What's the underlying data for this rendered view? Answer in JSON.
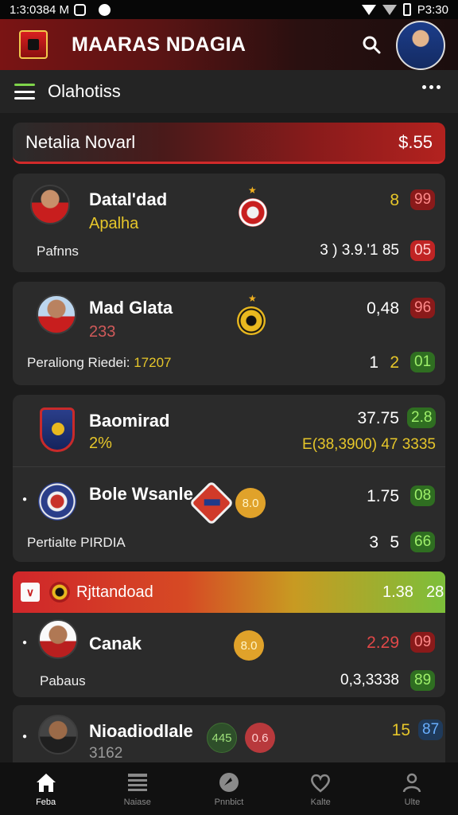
{
  "status_bar": {
    "time": "1:3:0384 M",
    "right_time": "P3:30"
  },
  "header": {
    "app_title": "MAARAS NDAGIA"
  },
  "subheader": {
    "title": "Olahotiss"
  },
  "banner": {
    "title": "Netalia Novarl",
    "value": "$.55"
  },
  "cards": [
    {
      "name": "Datal'dad",
      "subtitle": "Apalha",
      "label": "Pafnns",
      "top_value": "8",
      "top_badge": "99",
      "bottom_value": "3 ) 3.9.'1 85",
      "bottom_badge": "05"
    },
    {
      "name": "Mad Glata",
      "subtitle": "233",
      "label": "Peraliong Riedei:",
      "label_value": "17207",
      "top_value": "0,48",
      "top_badge": "96",
      "bottom_value_1": "1",
      "bottom_value_2": "2",
      "bottom_badge": "01"
    }
  ],
  "group_card": {
    "item1": {
      "name": "Baomirad",
      "subtitle": "2%",
      "top_value": "37.75",
      "top_badge": "2.8",
      "bottom_value": "E(38,3900) 47 3335"
    },
    "item2": {
      "name": "Bole Wsanle",
      "coin": "8.0",
      "label": "Pertialte PIRDIA",
      "top_value": "1.75",
      "top_badge": "08",
      "bottom_value_1": "3",
      "bottom_value_2": "5",
      "bottom_badge": "66"
    }
  },
  "section": {
    "title": "Rjttandoad",
    "value_1": "1.38",
    "value_2": "28"
  },
  "section_card": {
    "name": "Canak",
    "coin": "8.0",
    "label": "Pabaus",
    "top_value": "2.29",
    "top_badge": "09",
    "bottom_value": "0,3,3338",
    "bottom_badge": "89"
  },
  "last_card": {
    "name": "Nioadiodlale",
    "subtitle": "3162",
    "coin_green": "445",
    "coin_red": "0.6",
    "top_value": "15",
    "top_badge": "87"
  },
  "bottom_nav": [
    {
      "label": "Feba",
      "icon": "home-icon"
    },
    {
      "label": "Naiase",
      "icon": "list-icon"
    },
    {
      "label": "Pnnbict",
      "icon": "ball-icon"
    },
    {
      "label": "Kalte",
      "icon": "heart-icon"
    },
    {
      "label": "Ulte",
      "icon": "person-icon"
    }
  ],
  "colors": {
    "accent_red": "#c81e1e",
    "accent_green": "#7cbf3a",
    "accent_yellow": "#e6c62a",
    "background": "#1c1c1c",
    "card": "#2b2b2b"
  }
}
